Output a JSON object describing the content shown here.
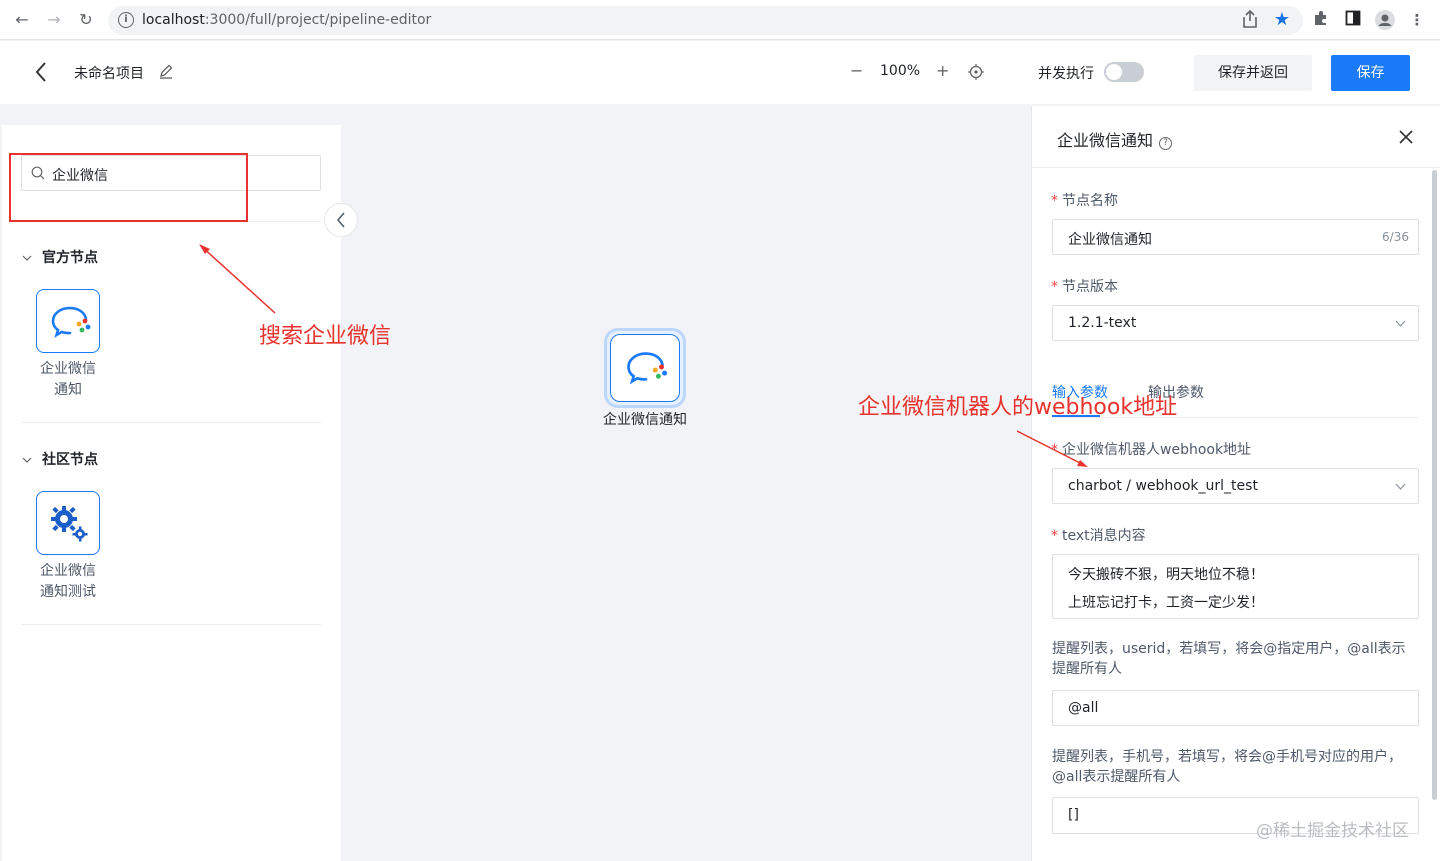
{
  "browser": {
    "url_host": "localhost",
    "url_path": ":3000/full/project/pipeline-editor"
  },
  "header": {
    "project_name": "未命名项目",
    "zoom": "100%",
    "zoom_minus": "−",
    "zoom_plus": "+",
    "concurrent_label": "并发执行",
    "concurrent_enabled": false,
    "save_back_label": "保存并返回",
    "save_label": "保存",
    "accent_color": "#1a7af8"
  },
  "left_panel": {
    "search_value": "企业微信",
    "groups": [
      {
        "title": "官方节点",
        "nodes": [
          {
            "label": "企业微信通知",
            "icon": "wecom-chat-icon"
          }
        ]
      },
      {
        "title": "社区节点",
        "nodes": [
          {
            "label": "企业微信通知测试",
            "icon": "gears-icon"
          }
        ]
      }
    ]
  },
  "canvas": {
    "node_label": "企业微信通知"
  },
  "annotations": {
    "search_note": "搜索企业微信",
    "webhook_note": "企业微信机器人的webhook地址",
    "color": "#e8322d"
  },
  "right_panel": {
    "title": "企业微信通知",
    "node_name_label": "节点名称",
    "node_name_value": "企业微信通知",
    "node_name_count": "6/36",
    "node_version_label": "节点版本",
    "node_version_value": "1.2.1-text",
    "tabs": [
      "输入参数",
      "输出参数"
    ],
    "webhook_label": "企业微信机器人webhook地址",
    "webhook_value": "charbot / webhook_url_test",
    "text_label": "text消息内容",
    "text_lines": [
      "今天搬砖不狠，明天地位不稳！",
      "上班忘记打卡，工资一定少发！"
    ],
    "userid_hint": "提醒列表，userid，若填写，将会@指定用户，@all表示提醒所有人",
    "userid_value": "@all",
    "mobile_hint": "提醒列表，手机号，若填写，将会@手机号对应的用户，@all表示提醒所有人",
    "mobile_value": "[]"
  },
  "watermark": "@稀土掘金技术社区"
}
